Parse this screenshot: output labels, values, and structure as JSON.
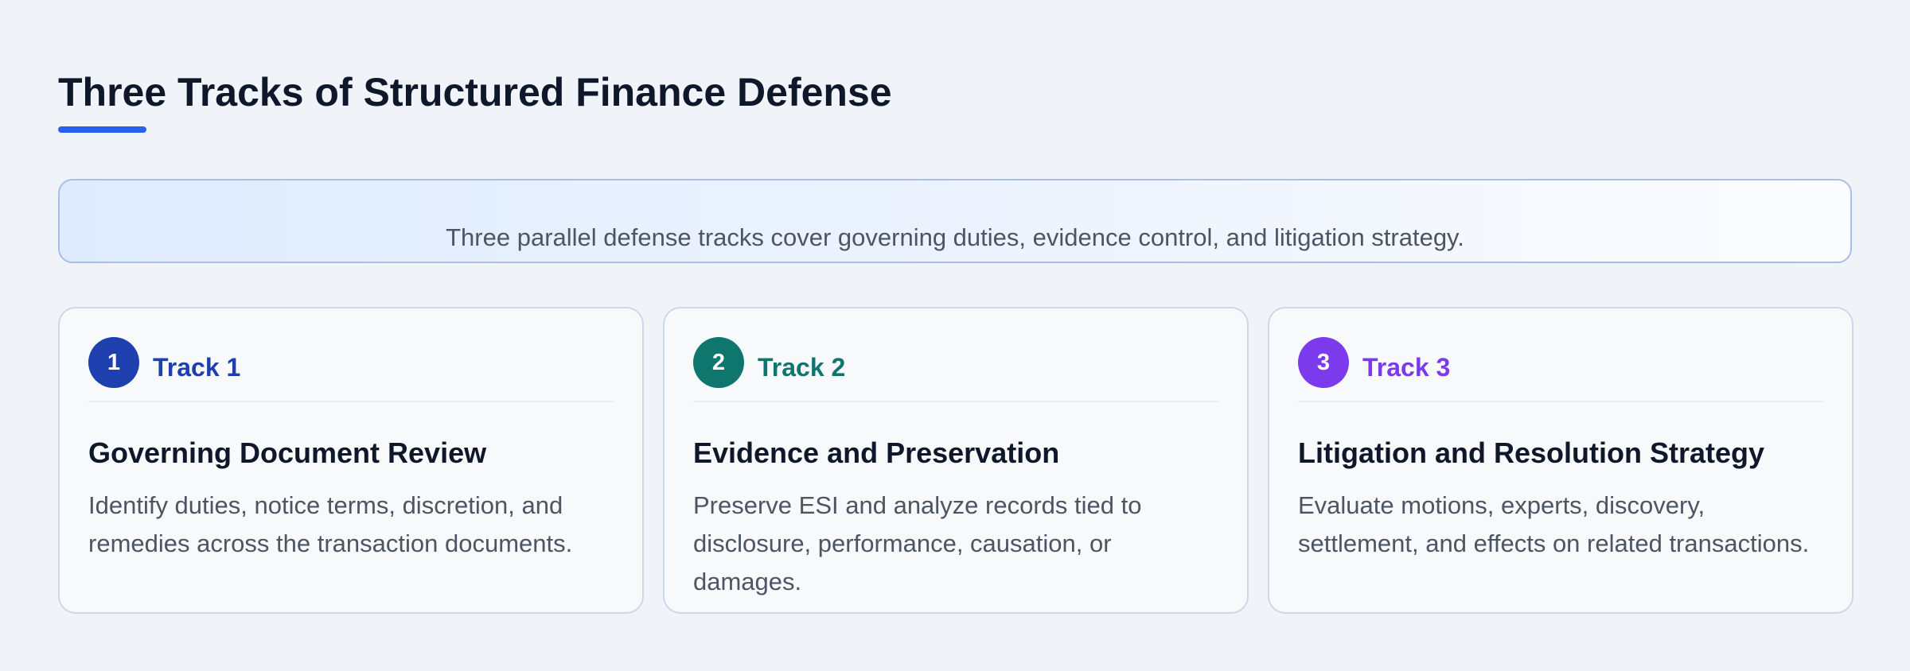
{
  "page": {
    "title": "Three Tracks of Structured Finance Defense",
    "summary": "Three parallel defense tracks cover governing duties, evidence control, and litigation strategy."
  },
  "colors": {
    "title_underline": "#2563eb",
    "track1": "#1e40af",
    "track2": "#0f766e",
    "track3": "#7c3aed"
  },
  "tracks": [
    {
      "number": "1",
      "label": "Track 1",
      "title": "Governing Document Review",
      "description": "Identify duties, notice terms, discretion, and remedies across the transaction documents.",
      "color": "#1e40af"
    },
    {
      "number": "2",
      "label": "Track 2",
      "title": "Evidence and Preservation",
      "description": "Preserve ESI and analyze records tied to disclosure, performance, causation, or damages.",
      "color": "#0f766e"
    },
    {
      "number": "3",
      "label": "Track 3",
      "title": "Litigation and Resolution Strategy",
      "description": "Evaluate motions, experts, discovery, settlement, and effects on related transactions.",
      "color": "#7c3aed"
    }
  ]
}
